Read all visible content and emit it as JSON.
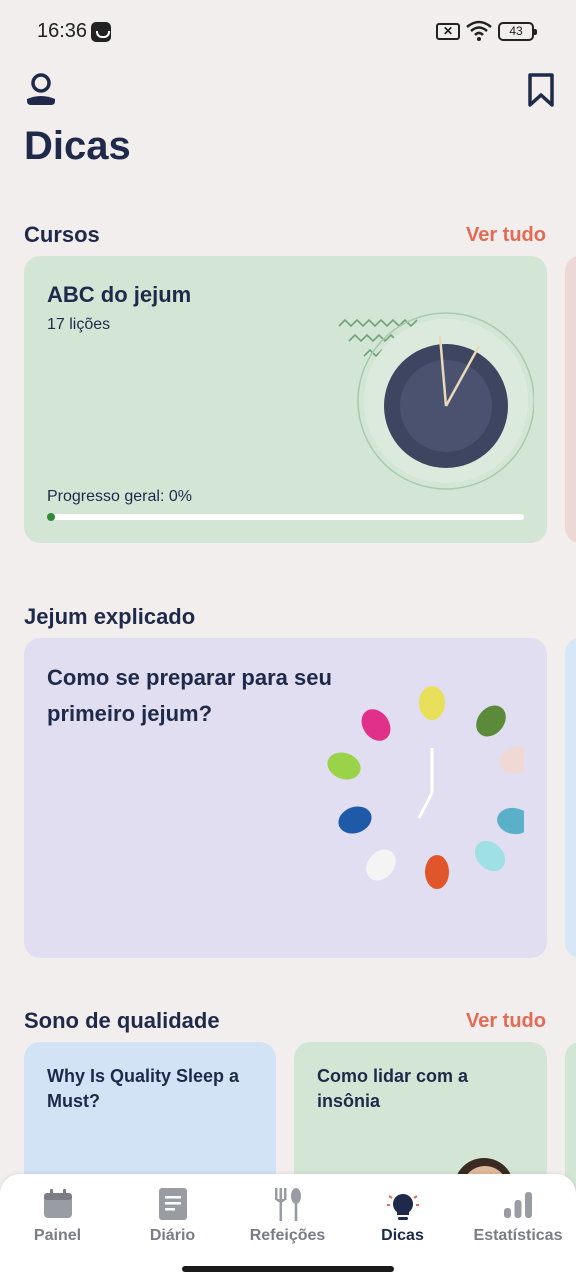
{
  "status_bar": {
    "time": "16:36",
    "battery": "43"
  },
  "header": {
    "title": "Dicas"
  },
  "courses": {
    "title": "Cursos",
    "see_all": "Ver tudo",
    "card": {
      "title": "ABC do jejum",
      "lessons": "17 lições",
      "progress_label": "Progresso geral: 0%",
      "progress": 0
    }
  },
  "fasting_explained": {
    "title": "Jejum explicado",
    "card": {
      "title": "Como se preparar para seu primeiro jejum?"
    }
  },
  "sleep": {
    "title": "Sono de qualidade",
    "see_all": "Ver tudo",
    "cards": [
      {
        "title": "Why Is Quality Sleep a Must?"
      },
      {
        "title": "Como lidar com a insônia"
      }
    ]
  },
  "bottom_nav": {
    "items": [
      {
        "label": "Painel",
        "icon": "calendar-icon"
      },
      {
        "label": "Diário",
        "icon": "journal-icon"
      },
      {
        "label": "Refeições",
        "icon": "fork-spoon-icon"
      },
      {
        "label": "Dicas",
        "icon": "lightbulb-icon",
        "active": true
      },
      {
        "label": "Estatísticas",
        "icon": "bar-chart-icon"
      }
    ]
  },
  "colors": {
    "accent": "#e56a54",
    "text_dark": "#1f2a4a",
    "background": "#f3eeee",
    "progress": "#2f8a3a"
  }
}
